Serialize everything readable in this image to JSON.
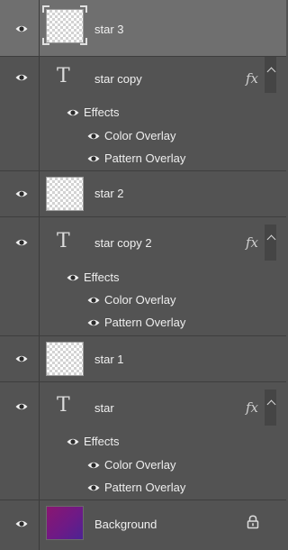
{
  "panel": {
    "layers": [
      {
        "name": "star 3",
        "kind": "raster",
        "selected": true
      },
      {
        "name": "star copy",
        "kind": "text",
        "fx": "fx",
        "effects_label": "Effects",
        "effects": [
          "Color Overlay",
          "Pattern Overlay"
        ]
      },
      {
        "name": "star 2",
        "kind": "raster"
      },
      {
        "name": "star copy 2",
        "kind": "text",
        "fx": "fx",
        "effects_label": "Effects",
        "effects": [
          "Color Overlay",
          "Pattern Overlay"
        ]
      },
      {
        "name": "star 1",
        "kind": "raster"
      },
      {
        "name": "star",
        "kind": "text",
        "fx": "fx",
        "effects_label": "Effects",
        "effects": [
          "Color Overlay",
          "Pattern Overlay"
        ]
      },
      {
        "name": "Background",
        "kind": "background",
        "locked": true
      }
    ],
    "text_layer_glyph": "T",
    "icons": {
      "visibility": "eye-icon",
      "effects": "fx-icon",
      "collapse": "chevron-up-icon",
      "lock": "lock-icon"
    },
    "colors": {
      "panel_bg": "#535353",
      "selected_bg": "#6f6f6f",
      "background_thumb": "#7a1a7e"
    }
  }
}
